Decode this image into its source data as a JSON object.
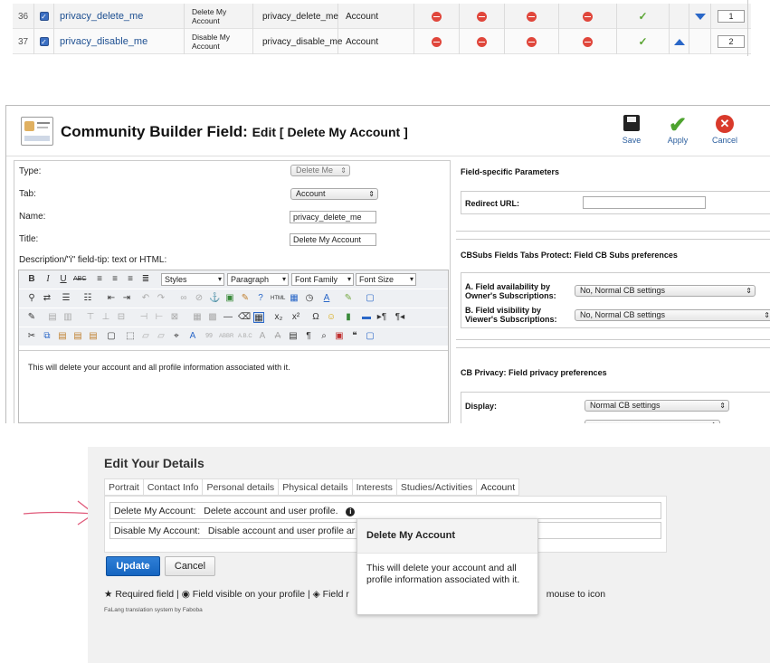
{
  "field_list": {
    "rows": [
      {
        "num": "36",
        "name": "privacy_delete_me",
        "title": "Delete My Account",
        "name2": "privacy_delete_me",
        "tab": "Account",
        "order": "1",
        "order_arrow": "down"
      },
      {
        "num": "37",
        "name": "privacy_disable_me",
        "title": "Disable My Account",
        "name2": "privacy_disable_me",
        "tab": "Account",
        "order": "2",
        "order_arrow": "up"
      }
    ],
    "deny_icon": "deny-icon",
    "tick_icon": "checkmark-icon",
    "tick_char": "✓",
    "check_char": "✓"
  },
  "cb_edit": {
    "title_main": "Community Builder Field:",
    "title_sub": "Edit [ Delete My Account ]",
    "toolbar": {
      "save": "Save",
      "apply": "Apply",
      "cancel": "Cancel"
    },
    "form": {
      "type_label": "Type:",
      "type_value": "Delete Me",
      "tab_label": "Tab:",
      "tab_value": "Account",
      "name_label": "Name:",
      "name_value": "privacy_delete_me",
      "title_label": "Title:",
      "title_value": "Delete My Account",
      "desc_label": "Description/\"i\" field-tip: text or HTML:"
    },
    "editor": {
      "styles": "Styles",
      "paragraph": "Paragraph",
      "font_family": "Font Family",
      "font_size": "Font Size",
      "content": "This will delete your account and all profile information associated with it."
    },
    "right": {
      "params_title": "Field-specific Parameters",
      "redirect_label": "Redirect URL:",
      "cbsubs_title": "CBSubs Fields Tabs Protect: Field CB Subs preferences",
      "avail_label": "A. Field availability by Owner's Subscriptions:",
      "avail_value": "No, Normal CB settings",
      "vis_label": "B. Field visibility by Viewer's Subscriptions:",
      "vis_value": "No, Normal CB settings",
      "privacy_title": "CB Privacy: Field privacy preferences",
      "display_label": "Display:",
      "display_value": "Normal CB settings"
    }
  },
  "details": {
    "title": "Edit Your Details",
    "tabs": [
      "Portrait",
      "Contact Info",
      "Personal details",
      "Physical details",
      "Interests",
      "Studies/Activities",
      "Account"
    ],
    "row1_label": "Delete My Account:",
    "row1_desc": "Delete account and user profile.",
    "row2_label": "Disable My Account:",
    "row2_desc": "Disable account and user profile ar",
    "update": "Update",
    "cancel": "Cancel",
    "legend_required": "Required field |",
    "legend_visible": "Field visible on your profile |",
    "legend_field_partial": "Field r",
    "legend_end": "mouse to icon",
    "falang": "FaLang translation system by Faboba",
    "tooltip_title": "Delete My Account",
    "tooltip_body": "This will delete your account and all profile information associated with it.",
    "annotation_arrow_color": "#e05a7a"
  }
}
